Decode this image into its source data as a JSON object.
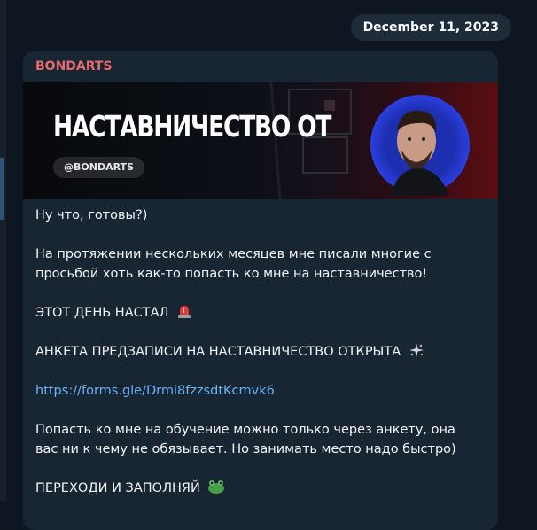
{
  "date_pill": "December 11, 2023",
  "message": {
    "author": "BONDARTS",
    "banner": {
      "title": "НАСТАВНИЧЕСТВО ОТ",
      "handle": "@BONDARTS"
    },
    "lines": {
      "l1": "Ну что, готовы?)",
      "l2": "На протяжении нескольких месяцев мне писали многие с",
      "l3": "просьбой хоть как-то попасть ко мне на наставничество!",
      "l4": "ЭТОТ ДЕНЬ НАСТАЛ",
      "l5": "АНКЕТА ПРЕДЗАПИСИ НА НАСТАВНИЧЕСТВО ОТКРЫТА",
      "link": "https://forms.gle/Drmi8fzzsdtKcmvk6",
      "l6": "Попасть ко мне на обучение можно только через анкету, она",
      "l7": "вас ни к чему не обязывает. Но занимать место надо быстро)",
      "l8": "ПЕРЕХОДИ И ЗАПОЛНЯЙ"
    },
    "emoji_icons": [
      "siren-icon",
      "sparkles-icon",
      "frog-icon"
    ]
  },
  "colors": {
    "background": "#0e1621",
    "bubble": "#182533",
    "author": "#e56a6a",
    "link": "#6ab3f3",
    "date_pill": "#1e2c3a"
  }
}
